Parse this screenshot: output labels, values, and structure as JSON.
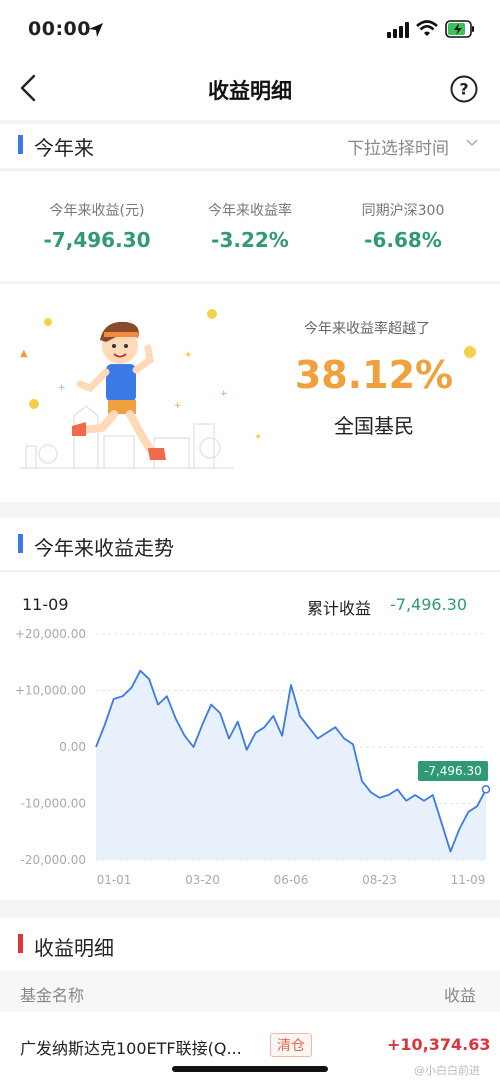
{
  "status_bar": {
    "time": "00:00"
  },
  "header": {
    "title": "收益明细"
  },
  "ytd_section": {
    "title": "今年来",
    "dropdown_label": "下拉选择时间",
    "stats": [
      {
        "label": "今年来收益(元)",
        "value": "-7,496.30"
      },
      {
        "label": "今年来收益率",
        "value": "-3.22%"
      },
      {
        "label": "同期沪深300",
        "value": "-6.68%"
      }
    ],
    "beat": {
      "label": "今年来收益率超越了",
      "value": "38.12%",
      "sub": "全国基民"
    }
  },
  "trend_section": {
    "title": "今年来收益走势",
    "date": "11-09",
    "cum_label": "累计收益",
    "cum_value": "-7,496.30",
    "last_tag": "-7,496.30"
  },
  "chart_data": {
    "type": "area",
    "x_ticks": [
      "01-01",
      "03-20",
      "06-06",
      "08-23",
      "11-09"
    ],
    "y_ticks": [
      "+20,000.00",
      "+10,000.00",
      "0.00",
      "-10,000.00",
      "-20,000.00"
    ],
    "ylim": [
      -20000,
      20000
    ],
    "x": [
      "01-01",
      "01-08",
      "01-15",
      "01-22",
      "01-29",
      "02-05",
      "02-12",
      "02-19",
      "02-26",
      "03-05",
      "03-12",
      "03-20",
      "03-27",
      "04-03",
      "04-10",
      "04-17",
      "04-24",
      "05-01",
      "05-08",
      "05-15",
      "05-22",
      "05-29",
      "06-06",
      "06-13",
      "06-20",
      "06-27",
      "07-04",
      "07-11",
      "07-18",
      "07-25",
      "08-01",
      "08-08",
      "08-15",
      "08-23",
      "08-30",
      "09-06",
      "09-13",
      "09-20",
      "09-27",
      "10-04",
      "10-11",
      "10-18",
      "10-25",
      "11-01",
      "11-09"
    ],
    "values": [
      0,
      4000,
      8500,
      9000,
      10500,
      13500,
      12000,
      7500,
      9000,
      5000,
      2000,
      0,
      4000,
      7500,
      6000,
      1500,
      4500,
      -500,
      2500,
      3500,
      5500,
      2000,
      11000,
      5500,
      3500,
      1500,
      2500,
      3500,
      1500,
      500,
      -6000,
      -8000,
      -9000,
      -8500,
      -7500,
      -9500,
      -8500,
      -9500,
      -8500,
      -13500,
      -18500,
      -14500,
      -11500,
      -10500,
      -7496.3
    ],
    "series_color": "#3a7be8",
    "fill_color": "#e8f0fc"
  },
  "detail_section": {
    "title": "收益明细",
    "columns": [
      "基金名称",
      "收益"
    ],
    "rows": [
      {
        "name": "广发纳斯达克100ETF联接(Q...",
        "badge": "清仓",
        "gain": "+10,374.63"
      }
    ]
  },
  "watermark": "@小白白前进"
}
